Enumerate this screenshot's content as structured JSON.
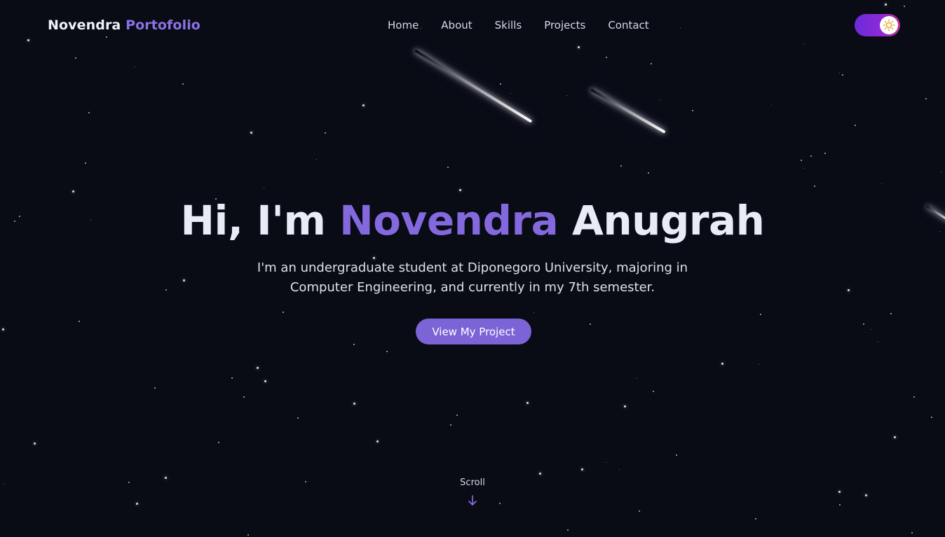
{
  "brand": {
    "first": "Novendra",
    "second": "Portofolio"
  },
  "nav": {
    "items": [
      {
        "label": "Home"
      },
      {
        "label": "About"
      },
      {
        "label": "Skills"
      },
      {
        "label": "Projects"
      },
      {
        "label": "Contact"
      }
    ]
  },
  "theme_toggle": {
    "state": "dark",
    "icon": "sun-icon"
  },
  "hero": {
    "greeting": "Hi, I'm",
    "name_highlight": "Novendra",
    "name_rest": "Anugrah",
    "subtitle_line1": "I'm an undergraduate student at Diponegoro University, majoring in",
    "subtitle_line2": "Computer Engineering, and currently in my 7th semester.",
    "cta_label": "View My Project"
  },
  "scroll": {
    "label": "Scroll",
    "icon": "arrow-down-icon"
  },
  "colors": {
    "background": "#090b15",
    "accent": "#8468de",
    "button": "#7d64d6",
    "toggle_start": "#6a2bd9",
    "toggle_end": "#b8318f"
  }
}
